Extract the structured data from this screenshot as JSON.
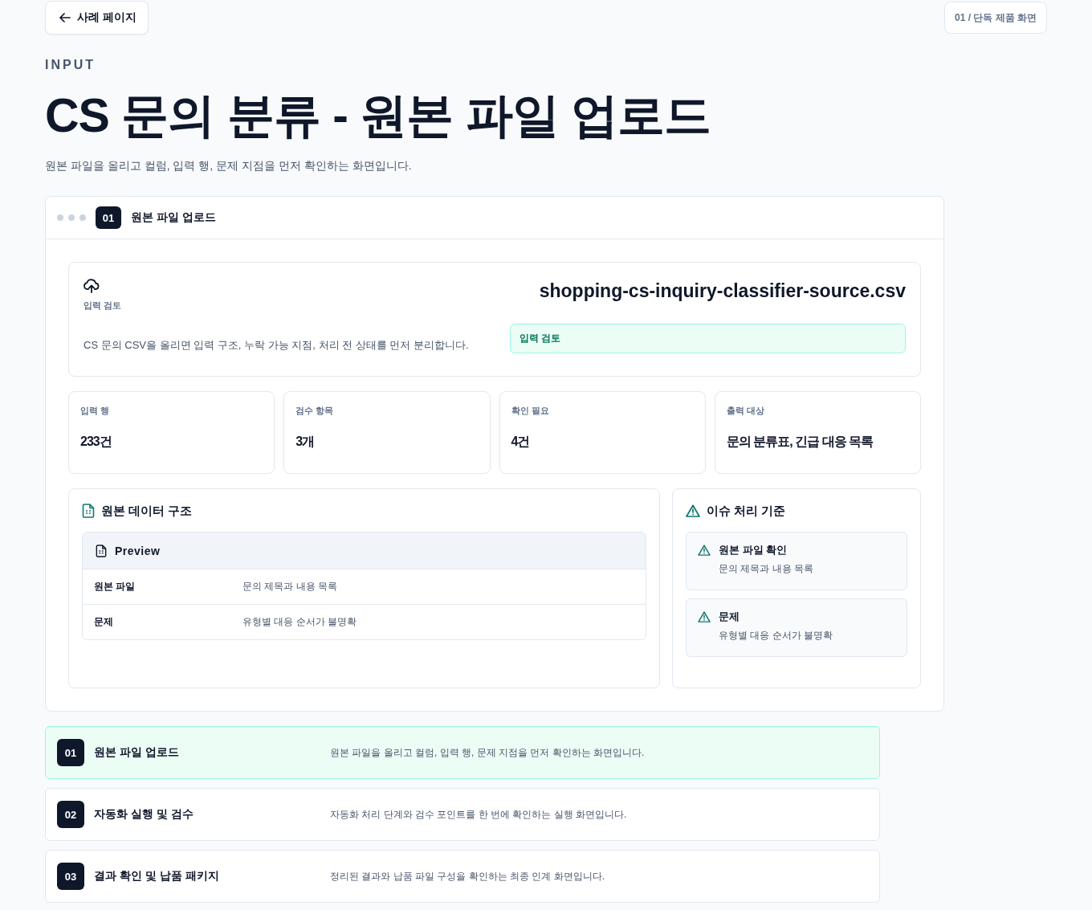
{
  "top_bar": {
    "back_button": "사례 페이지",
    "badge": "01 / 단독 제품 화면"
  },
  "header": {
    "eyebrow": "INPUT",
    "title": "CS 문의 분류 - 원본 파일 업로드",
    "subtitle": "원본 파일을 올리고 컬럼, 입력 행, 문제 지점을 먼저 확인하는 화면입니다."
  },
  "panel": {
    "step_number": "01",
    "title": "원본 파일 업로드",
    "hero": {
      "label": "입력 검토",
      "description": "CS 문의 CSV을 올리면 입력 구조, 누락 가능 지점, 처리 전 상태를 먼저 분리합니다.",
      "file_name": "shopping-cs-inquiry-classifier-source.csv",
      "status": "입력 검토"
    },
    "stats": [
      {
        "label": "입력 행",
        "value": "233건"
      },
      {
        "label": "검수 항목",
        "value": "3개"
      },
      {
        "label": "확인 필요",
        "value": "4건"
      },
      {
        "label": "출력 대상",
        "value": "문의 분류표, 긴급 대응 목록"
      }
    ],
    "data_structure": {
      "title": "원본 데이터 구조",
      "preview_title": "Preview",
      "rows": [
        {
          "label": "원본 파일",
          "value": "문의 제목과 내용 목록"
        },
        {
          "label": "문제",
          "value": "유형별 대응 순서가 불명확"
        }
      ]
    },
    "issues": {
      "title": "이슈 처리 기준",
      "items": [
        {
          "title": "원본 파일 확인",
          "detail": "문의 제목과 내용 목록"
        },
        {
          "title": "문제",
          "detail": "유형별 대응 순서가 불명확"
        }
      ]
    }
  },
  "steps": [
    {
      "number": "01",
      "title": "원본 파일 업로드",
      "description": "원본 파일을 올리고 컬럼, 입력 행, 문제 지점을 먼저 확인하는 화면입니다.",
      "selected": true
    },
    {
      "number": "02",
      "title": "자동화 실행 및 검수",
      "description": "자동화 처리 단계와 검수 포인트를 한 번에 확인하는 실행 화면입니다.",
      "selected": false
    },
    {
      "number": "03",
      "title": "결과 확인 및 납품 패키지",
      "description": "정리된 결과와 납품 파일 구성을 확인하는 최종 인계 화면입니다.",
      "selected": false
    }
  ]
}
